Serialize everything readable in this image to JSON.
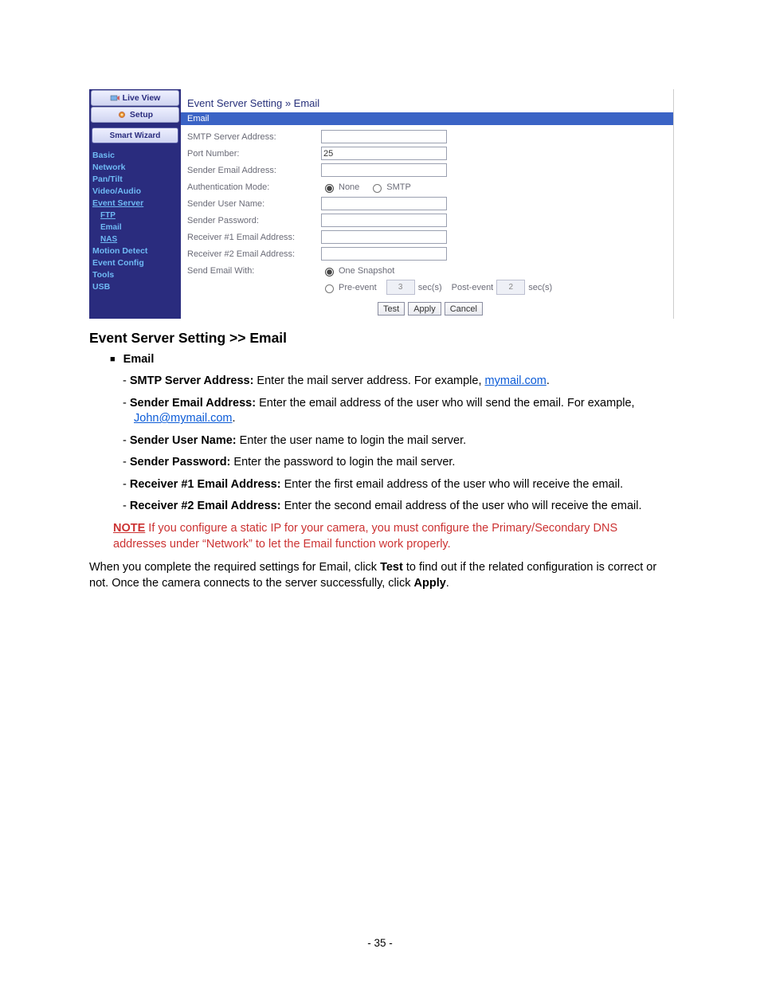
{
  "app": {
    "top_tabs": {
      "live_view": "Live View",
      "setup": "Setup"
    },
    "wizard_label": "Smart Wizard",
    "sidebar": {
      "basic": "Basic",
      "network": "Network",
      "pantilt": "Pan/Tilt",
      "video_audio": "Video/Audio",
      "event_server": "Event Server",
      "ftp": "FTP",
      "email": "Email",
      "nas": "NAS",
      "motion_detect": "Motion Detect",
      "event_config": "Event Config",
      "tools": "Tools",
      "usb": "USB"
    },
    "breadcrumb": "Event Server Setting » Email",
    "section_header": "Email",
    "labels": {
      "smtp_server": "SMTP Server Address:",
      "port_number": "Port Number:",
      "sender_email": "Sender Email Address:",
      "auth_mode": "Authentication Mode:",
      "sender_user": "Sender User Name:",
      "sender_pass": "Sender Password:",
      "recv1": "Receiver #1 Email Address:",
      "recv2": "Receiver #2 Email Address:",
      "send_with": "Send Email With:"
    },
    "values": {
      "smtp_server": "",
      "port_number": "25",
      "sender_email": "",
      "sender_user": "",
      "sender_pass": "",
      "recv1": "",
      "recv2": ""
    },
    "auth": {
      "none": "None",
      "smtp": "SMTP"
    },
    "send_with": {
      "one_snapshot": "One Snapshot",
      "pre_event": "Pre-event",
      "pre_event_val": "3",
      "secs1": "sec(s)",
      "post_event": "Post-event",
      "post_event_val": "2",
      "secs2": "sec(s)"
    },
    "buttons": {
      "test": "Test",
      "apply": "Apply",
      "cancel": "Cancel"
    }
  },
  "doc": {
    "heading": "Event Server Setting >> Email",
    "email_header": "Email",
    "items": {
      "smtp_label": "SMTP Server Address:",
      "smtp_text_a": " Enter the mail server address. For example, ",
      "smtp_link": "mymail.com",
      "smtp_text_b": ".",
      "sender_label": "Sender Email Address:",
      "sender_text_a": " Enter the email address of the user who will send the email. For example, ",
      "sender_link": "John@mymail.com",
      "sender_text_b": ".",
      "user_label": "Sender User Name:",
      "user_text": " Enter the user name to login the mail server.",
      "pass_label": "Sender Password:",
      "pass_text": " Enter the password to login the mail server.",
      "r1_label": "Receiver #1 Email Address:",
      "r1_text": " Enter the first email address of the user who will receive the email.",
      "r2_label": "Receiver #2 Email Address:",
      "r2_text": " Enter the second email address of the user who will receive the email."
    },
    "note_label": "NOTE",
    "note_text": "   If you configure a static IP for your camera, you must configure the Primary/Secondary DNS addresses under “Network” to let the Email function work properly.",
    "body_a": "When you complete the required settings for Email, click ",
    "body_b": "Test",
    "body_c": " to find out if the related configuration is correct or not. Once the camera connects to the server successfully, click ",
    "body_d": "Apply",
    "body_e": "."
  },
  "page_number": "- 35 -"
}
